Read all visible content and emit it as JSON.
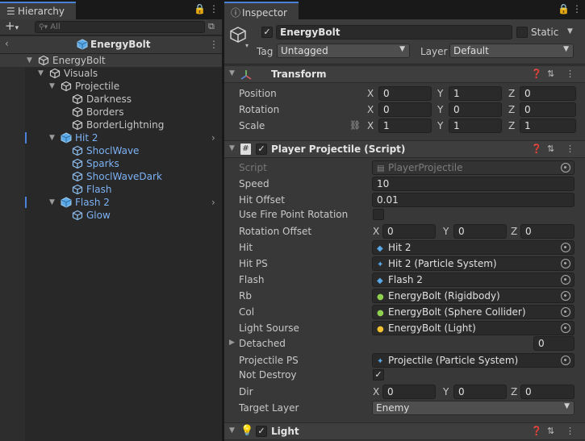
{
  "hierarchy": {
    "tab_label": "Hierarchy",
    "search_placeholder": "All",
    "scene_title": "EnergyBolt",
    "items": [
      {
        "label": "EnergyBolt"
      },
      {
        "label": "Visuals"
      },
      {
        "label": "Projectile"
      },
      {
        "label": "Darkness"
      },
      {
        "label": "Borders"
      },
      {
        "label": "BorderLightning"
      },
      {
        "label": "Hit 2"
      },
      {
        "label": "ShoclWave"
      },
      {
        "label": "Sparks"
      },
      {
        "label": "ShoclWaveDark"
      },
      {
        "label": "Flash"
      },
      {
        "label": "Flash 2"
      },
      {
        "label": "Glow"
      }
    ]
  },
  "inspector": {
    "tab_label": "Inspector",
    "object_name": "EnergyBolt",
    "static_label": "Static",
    "tag_label": "Tag",
    "tag_value": "Untagged",
    "layer_label": "Layer",
    "layer_value": "Default",
    "transform": {
      "title": "Transform",
      "position_label": "Position",
      "rotation_label": "Rotation",
      "scale_label": "Scale",
      "axis_x": "X",
      "axis_y": "Y",
      "axis_z": "Z",
      "position": [
        "0",
        "1",
        "0"
      ],
      "rotation": [
        "0",
        "0",
        "0"
      ],
      "scale": [
        "1",
        "1",
        "1"
      ]
    },
    "script": {
      "title": "Player Projectile (Script)",
      "fields": {
        "script_label": "Script",
        "script_value": "PlayerProjectile",
        "speed_label": "Speed",
        "speed_value": "10",
        "hit_offset_label": "Hit Offset",
        "hit_offset_value": "0.01",
        "use_fire_point_label": "Use Fire Point Rotation",
        "rotation_offset_label": "Rotation Offset",
        "rotation_offset": [
          "0",
          "0",
          "0"
        ],
        "hit_label": "Hit",
        "hit_value": "Hit 2",
        "hit_ps_label": "Hit PS",
        "hit_ps_value": "Hit 2 (Particle System)",
        "flash_label": "Flash",
        "flash_value": "Flash 2",
        "rb_label": "Rb",
        "rb_value": "EnergyBolt (Rigidbody)",
        "col_label": "Col",
        "col_value": "EnergyBolt (Sphere Collider)",
        "light_source_label": "Light Sourse",
        "light_source_value": "EnergyBolt (Light)",
        "detached_label": "Detached",
        "detached_value": "0",
        "projectile_ps_label": "Projectile PS",
        "projectile_ps_value": "Projectile (Particle System)",
        "not_destroy_label": "Not Destroy",
        "dir_label": "Dir",
        "dir": [
          "0",
          "0",
          "0"
        ],
        "target_layer_label": "Target Layer",
        "target_layer_value": "Enemy"
      }
    },
    "light": {
      "title": "Light"
    }
  },
  "colors": {
    "accent": "#4a82d9",
    "child_text": "#7cb2f4"
  },
  "icons": [
    "hierarchy-icon",
    "lock-icon",
    "kebab-menu-icon",
    "info-icon",
    "cube-icon",
    "prefab-cube-icon",
    "help-icon",
    "preset-icon",
    "transform-icon",
    "script-icon",
    "light-bulb-icon",
    "target-picker-icon"
  ]
}
